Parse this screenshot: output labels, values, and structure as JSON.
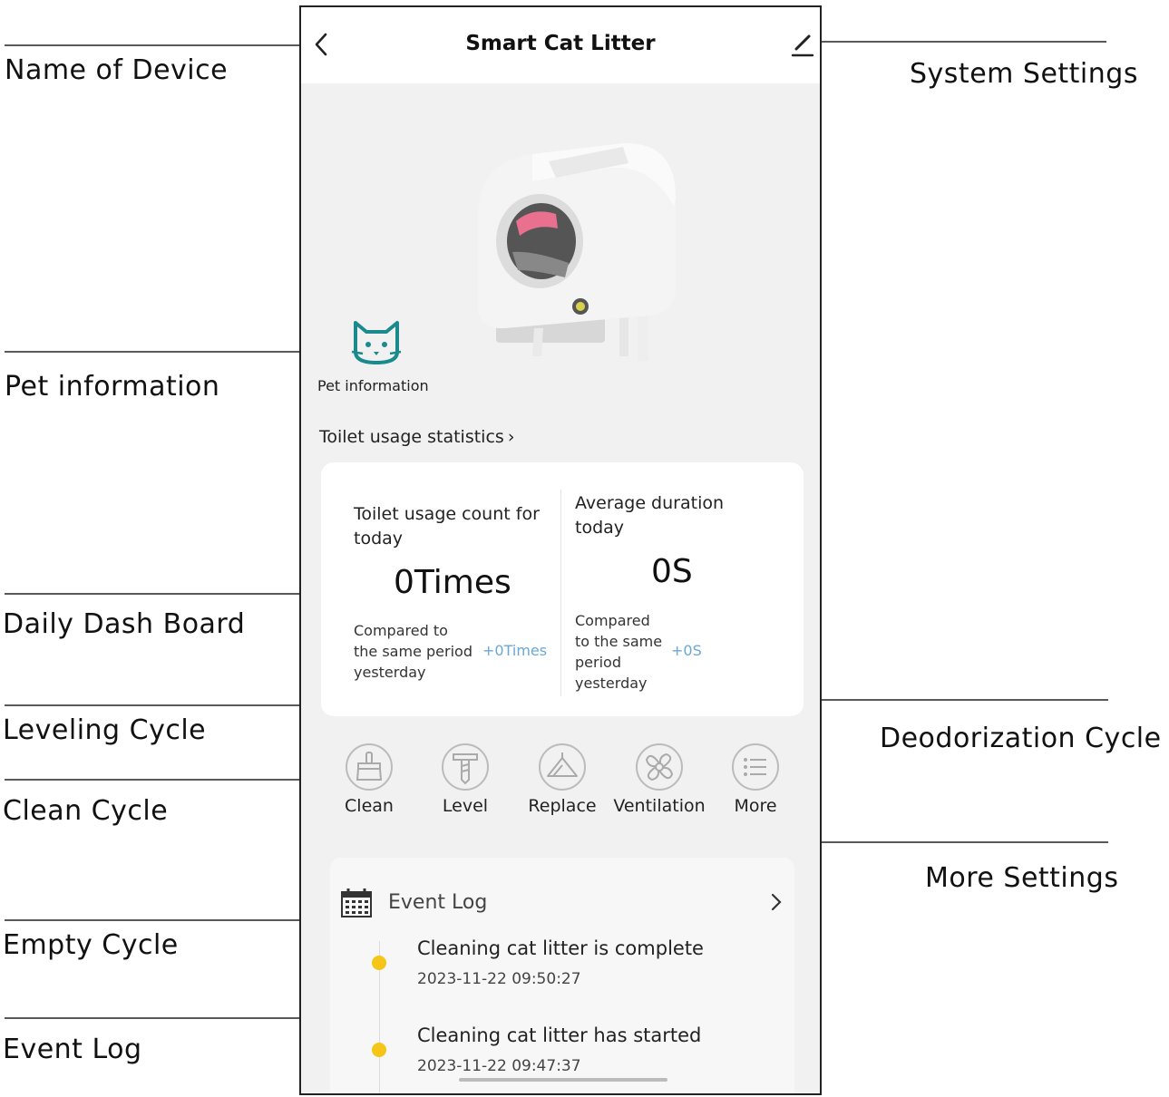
{
  "callouts": {
    "name_of_device": "Name  of  Device",
    "system_settings": "System Settings",
    "pet_information": "Pet information",
    "daily_dash_board": "Daily Dash Board",
    "leveling_cycle": "Leveling Cycle",
    "deodorization_cycle": "Deodorization Cycle",
    "clean_cycle": "Clean Cycle",
    "more_settings": "More Settings",
    "empty_cycle": "Empty Cycle",
    "event_log": "Event Log"
  },
  "app": {
    "title": "Smart Cat Litter",
    "pet_info_label": "Pet information",
    "stats_link": "Toilet usage statistics",
    "dashboard": {
      "left": {
        "heading_line1": "Toilet usage count for",
        "heading_line2": "today",
        "value": "0Times",
        "compare_line1": "Compared to",
        "compare_line2": "the same period",
        "compare_line3": "yesterday",
        "delta": "+0Times"
      },
      "right": {
        "heading_line1": "Average duration",
        "heading_line2": "today",
        "value": "0S",
        "compare_line1": "Compared",
        "compare_line2": "to the same",
        "compare_line3": "period",
        "compare_line4": "yesterday",
        "delta": "+0S"
      }
    },
    "actions": [
      {
        "label": "Clean",
        "icon": "broom-icon"
      },
      {
        "label": "Level",
        "icon": "level-icon"
      },
      {
        "label": "Replace",
        "icon": "replace-icon"
      },
      {
        "label": "Ventilation",
        "icon": "fan-icon"
      },
      {
        "label": "More",
        "icon": "list-icon"
      }
    ],
    "event_log": {
      "title": "Event Log",
      "events": [
        {
          "text": "Cleaning cat litter is complete",
          "time": "2023-11-22 09:50:27"
        },
        {
          "text": "Cleaning cat litter has started",
          "time": "2023-11-22 09:47:37"
        }
      ]
    }
  },
  "colors": {
    "accent_teal": "#1a8a8f",
    "event_dot": "#f5c518",
    "delta_blue": "#6aa8d6"
  }
}
